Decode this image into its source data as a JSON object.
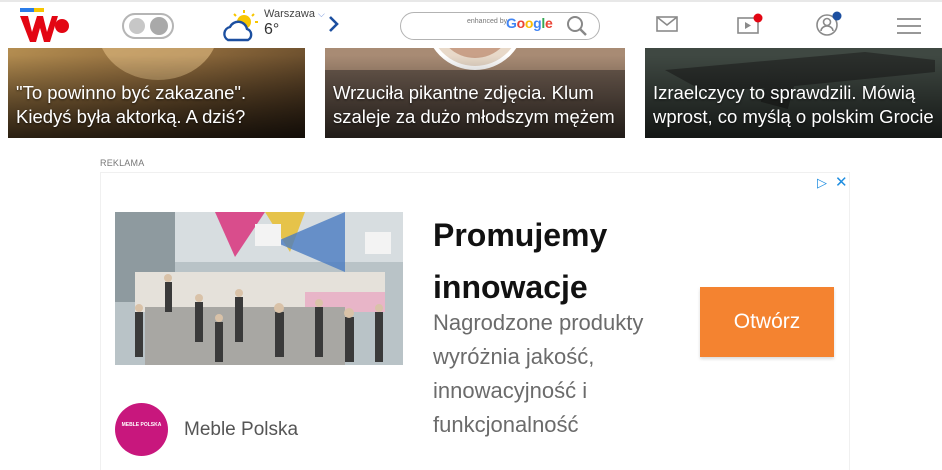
{
  "header": {
    "weather": {
      "city": "Warszawa",
      "temperature": "6°"
    },
    "search": {
      "branding_prefix": "enhanced by",
      "branding_google": "Google"
    }
  },
  "articles": [
    {
      "title": "\"To powinno być zakazane\". Kiedyś była aktorką. A dziś?"
    },
    {
      "title": "Wrzuciła pikantne zdjęcia. Klum szaleje za dużo młodszym mężem"
    },
    {
      "title": "Izraelczycy to sprawdzili. Mówią wprost, co myślą o polskim Grocie"
    }
  ],
  "ad": {
    "label": "REKLAMA",
    "headline": "Promujemy innowacje",
    "description": "Nagrodzone produkty wyróżnia jakość, innowacyjność i funkcjonalność",
    "cta_label": "Otwórz",
    "advertiser": "Meble Polska",
    "advertiser_logo_text": "MEBLE POLSKA",
    "choices_glyph": "▷",
    "close_glyph": "✕"
  },
  "colors": {
    "cta": "#f48330",
    "advertiser_logo": "#c8177d",
    "ad_choices": "#1e8de0",
    "logo_red": "#e30613"
  },
  "icons": [
    "wp-logo",
    "theme-toggle-icon",
    "weather-icon",
    "chevron-right-icon",
    "search-icon",
    "mail-icon",
    "video-icon",
    "user-icon",
    "menu-icon"
  ]
}
